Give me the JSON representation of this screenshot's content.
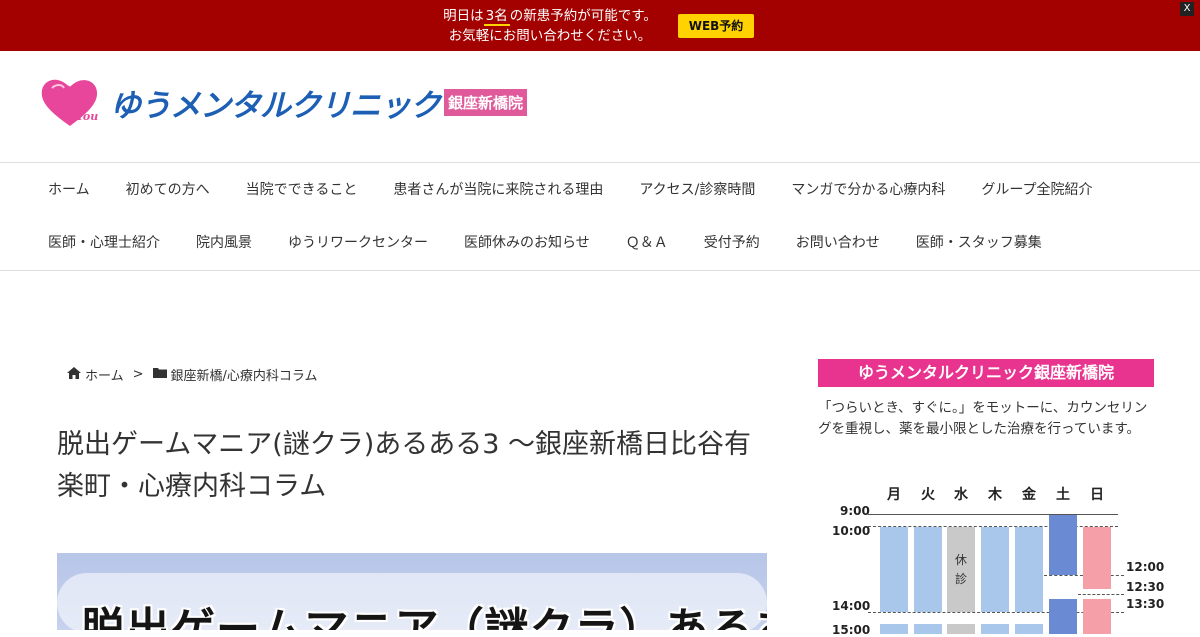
{
  "banner": {
    "line1_pre": "明日は",
    "count": "3名",
    "line1_post": "の新患予約が可能です。",
    "line2": "お気軽にお問い合わせください。",
    "web_button": "WEB予約",
    "close": "X"
  },
  "logo": {
    "you": "You",
    "name": "ゆうメンタルクリニック",
    "branch": "銀座新橋院"
  },
  "nav": {
    "row1": [
      "ホーム",
      "初めての方へ",
      "当院でできること",
      "患者さんが当院に来院される理由",
      "アクセス/診察時間",
      "マンガで分かる心療内科",
      "グループ全院紹介"
    ],
    "row2": [
      "医師・心理士紹介",
      "院内風景",
      "ゆうリワークセンター",
      "医師休みのお知らせ",
      "Ｑ＆Ａ",
      "受付予約",
      "お問い合わせ",
      "医師・スタッフ募集"
    ]
  },
  "breadcrumb": {
    "home": "ホーム",
    "separator": ">",
    "category": "銀座新橋/心療内科コラム"
  },
  "post": {
    "title": "脱出ゲームマニア(謎クラ)あるある3 ～銀座新橋日比谷有楽町・心療内科コラム",
    "eyecatch_text": "脱出ゲームマニア（謎クラ）あるある"
  },
  "sidebar": {
    "heading": "ゆうメンタルクリニック銀座新橋院",
    "description": "「つらいとき、すぐに。」をモットーに、カウンセリングを重視し、薬を最小限とした治療を行っています。"
  },
  "schedule": {
    "days": [
      "月",
      "火",
      "水",
      "木",
      "金",
      "土",
      "日"
    ],
    "times_left": [
      "9:00",
      "10:00",
      "14:00",
      "15:00"
    ],
    "times_right": [
      "12:00",
      "12:30",
      "13:30"
    ],
    "closed_label_1": "休",
    "closed_label_2": "診"
  },
  "colors": {
    "banner": "#a30000",
    "accent_yellow": "#ffd200",
    "brand_blue": "#1d5fb5",
    "brand_pink": "#e8338f",
    "weekday_bar": "#a9c7ea",
    "saturday_bar": "#6a8ad3",
    "sunday_bar": "#f5a0a8",
    "closed_bar": "#c9c9c9"
  }
}
